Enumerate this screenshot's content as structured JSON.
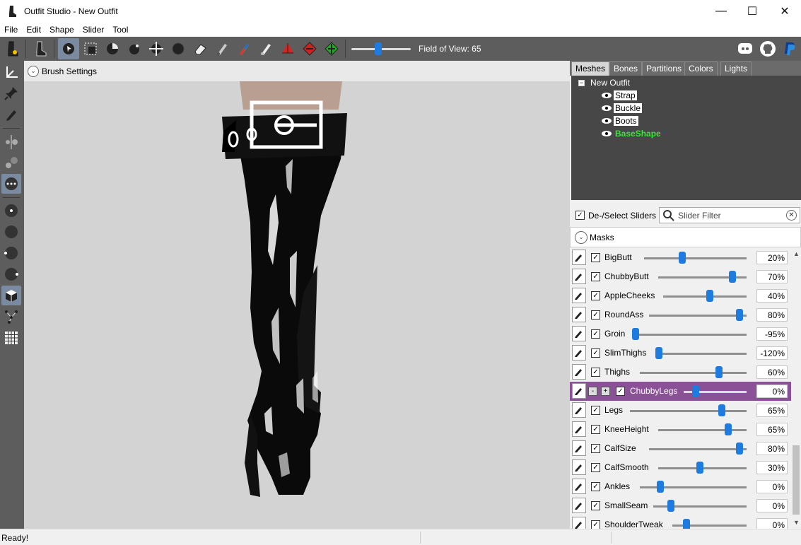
{
  "window": {
    "title": "Outfit Studio - New Outfit",
    "minimize": "—",
    "maximize": "☐",
    "close": "✕"
  },
  "menu": [
    "File",
    "Edit",
    "Shape",
    "Slider",
    "Tool"
  ],
  "toolbar": {
    "fov_label": "Field of View: 65",
    "fov_value": 65,
    "accent": "#1e7be0"
  },
  "viewport": {
    "brush_settings_label": "Brush Settings",
    "background": "#d3d3d3"
  },
  "tabs": [
    "Meshes",
    "Bones",
    "Partitions",
    "Colors",
    "Lights"
  ],
  "tree": {
    "root": "New Outfit",
    "nodes": [
      "Strap",
      "Buckle",
      "Boots",
      "BaseShape"
    ],
    "base_color": "#39e639"
  },
  "slider_panel": {
    "deselect_label": "De-/Select Sliders",
    "filter_placeholder": "Slider Filter",
    "masks_label": "Masks"
  },
  "sliders": [
    {
      "name": "BigButt",
      "value": "20%"
    },
    {
      "name": "ChubbyButt",
      "value": "70%"
    },
    {
      "name": "AppleCheeks",
      "value": "40%"
    },
    {
      "name": "RoundAss",
      "value": "80%"
    },
    {
      "name": "Groin",
      "value": "-95%"
    },
    {
      "name": "SlimThighs",
      "value": "-120%"
    },
    {
      "name": "Thighs",
      "value": "60%"
    },
    {
      "name": "ChubbyLegs",
      "value": "0%",
      "selected": true,
      "minus": "-",
      "plus": "+"
    },
    {
      "name": "Legs",
      "value": "65%"
    },
    {
      "name": "KneeHeight",
      "value": "65%"
    },
    {
      "name": "CalfSize",
      "value": "80%"
    },
    {
      "name": "CalfSmooth",
      "value": "30%"
    },
    {
      "name": "Ankles",
      "value": "0%"
    },
    {
      "name": "SmallSeam",
      "value": "0%"
    },
    {
      "name": "ShoulderTweak",
      "value": "0%"
    }
  ],
  "status": {
    "text": "Ready!"
  }
}
